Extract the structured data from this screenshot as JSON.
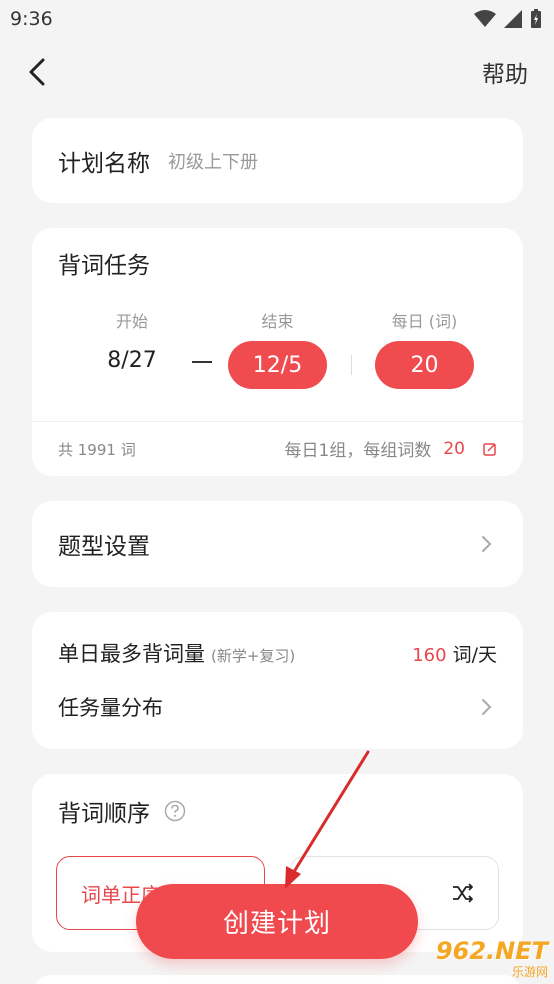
{
  "status_bar": {
    "time": "9:36"
  },
  "nav": {
    "help_label": "帮助"
  },
  "plan_name": {
    "label": "计划名称",
    "value": "初级上下册"
  },
  "task": {
    "title": "背词任务",
    "start_label": "开始",
    "end_label": "结束",
    "daily_label": "每日 (词)",
    "start_date": "8/27",
    "end_date": "12/5",
    "daily_count": "20",
    "total_text": "共 1991 词",
    "group_text": "每日1组，每组词数",
    "group_count": "20"
  },
  "question_type": {
    "label": "题型设置"
  },
  "limit": {
    "label": "单日最多背词量",
    "sub_label": "(新学+复习)",
    "value": "160",
    "unit": "词/天",
    "distribution_label": "任务量分布"
  },
  "order": {
    "title": "背词顺序",
    "option_a": "词单正序",
    "option_b": "随机排序"
  },
  "create_button": "创建计划",
  "watermark": {
    "main": "962.NET",
    "sub": "乐游网"
  },
  "colors": {
    "accent": "#f04b4f",
    "background": "#f4f4f4",
    "card": "#ffffff"
  }
}
